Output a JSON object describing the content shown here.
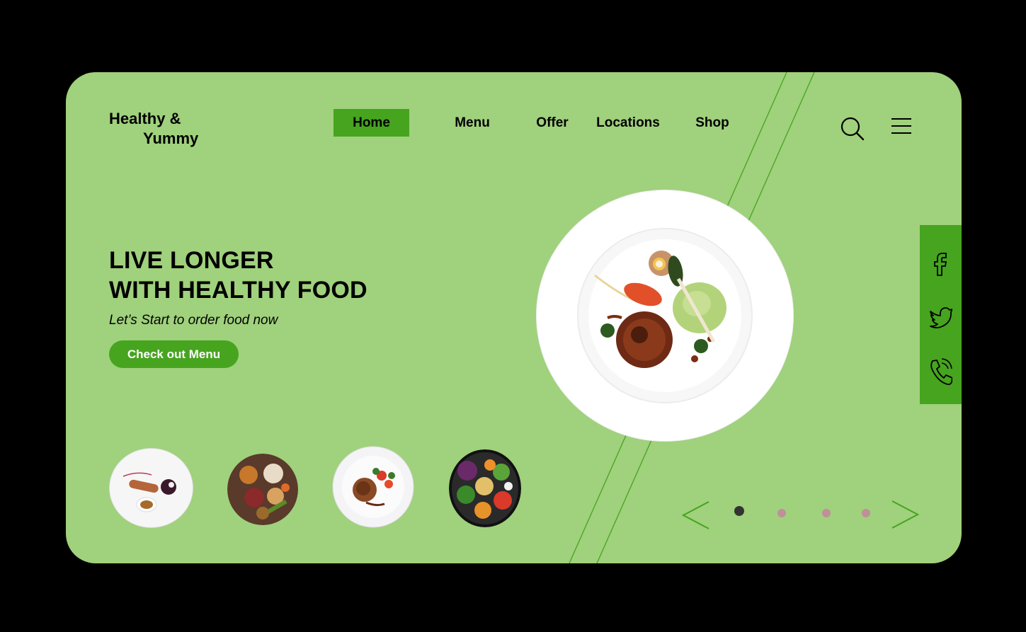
{
  "brand": {
    "line1": "Healthy &",
    "line2": "Yummy"
  },
  "nav": {
    "items": [
      {
        "label": "Home",
        "active": true
      },
      {
        "label": "Menu",
        "active": false
      },
      {
        "label": "Offer",
        "active": false
      },
      {
        "label": "Locations",
        "active": false
      },
      {
        "label": "Shop",
        "active": false
      }
    ]
  },
  "header_icons": [
    "search-icon",
    "menu-icon"
  ],
  "hero": {
    "headline_line1": "LIVE LONGER",
    "headline_line2": "WITH HEALTHY FOOD",
    "subtitle": "Let’s Start to order food now",
    "cta_label": "Check out Menu"
  },
  "social": [
    "facebook-icon",
    "twitter-icon",
    "phone-icon"
  ],
  "carousel": {
    "slide_count": 4,
    "active_index": 0
  },
  "colors": {
    "background": "#a0d17d",
    "accent": "#46a41f",
    "dot_active": "#333333",
    "dot_inactive": "#c08f9a"
  }
}
